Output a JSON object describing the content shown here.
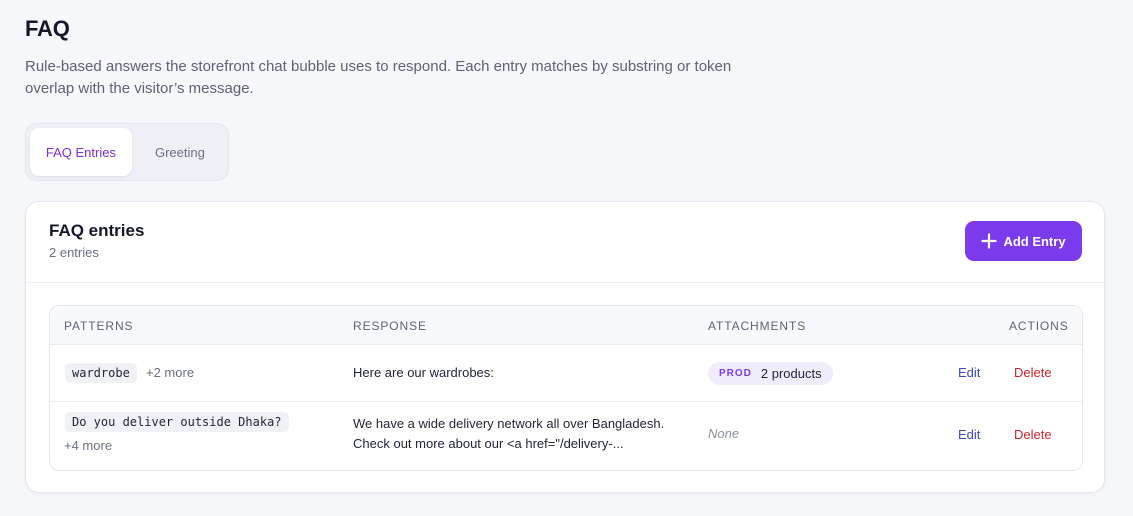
{
  "page": {
    "title": "FAQ",
    "subtitle": "Rule-based answers the storefront chat bubble uses to respond. Each entry matches by substring or token overlap with the visitor’s message."
  },
  "tabs": [
    {
      "label": "FAQ Entries",
      "active": true
    },
    {
      "label": "Greeting",
      "active": false
    }
  ],
  "card": {
    "title": "FAQ entries",
    "count": "2 entries",
    "add_button": "Add Entry"
  },
  "table": {
    "columns": [
      "PATTERNS",
      "RESPONSE",
      "ATTACHMENTS",
      "ACTIONS"
    ],
    "rows": [
      {
        "pattern": "wardrobe",
        "more": "+2 more",
        "response_line1": "Here are our wardrobes:",
        "response_line2": "",
        "attachment_tag": "PROD",
        "attachment_text": "2 products",
        "edit": "Edit",
        "delete": "Delete"
      },
      {
        "pattern": "Do you deliver outside Dhaka?",
        "more": "+4 more",
        "response_line1": "We have a wide delivery network all over Bangladesh.",
        "response_line2": "Check out more about our <a href=\"/delivery-...",
        "attachment_none": "None",
        "edit": "Edit",
        "delete": "Delete"
      }
    ]
  },
  "colors": {
    "accent": "#7c3aed",
    "link": "#3b4bbf",
    "danger": "#c8262d"
  }
}
